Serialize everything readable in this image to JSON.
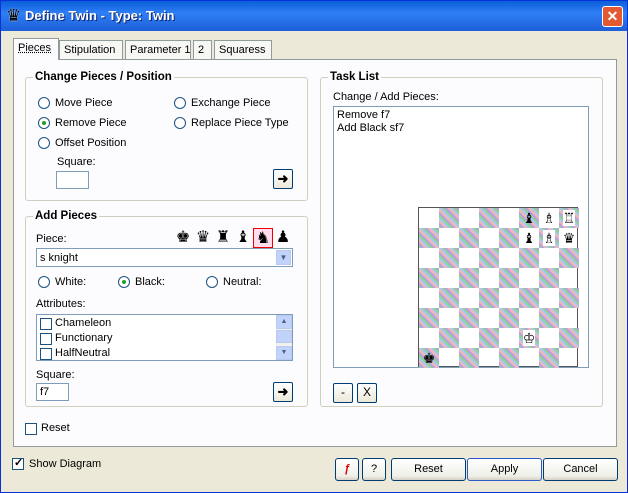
{
  "window": {
    "title": "Define Twin - Type: Twin",
    "app_icon": "queen-icon",
    "close_icon": "close-icon"
  },
  "tabs": [
    {
      "label": "Pieces",
      "active": true
    },
    {
      "label": "Stipulation"
    },
    {
      "label": "Parameter 1"
    },
    {
      "label": "2"
    },
    {
      "label": "Squaress"
    }
  ],
  "change_pieces": {
    "legend": "Change Pieces / Position",
    "options": [
      {
        "label": "Move Piece",
        "selected": false
      },
      {
        "label": "Exchange Piece",
        "selected": false
      },
      {
        "label": "Remove Piece",
        "selected": true
      },
      {
        "label": "Replace Piece Type",
        "selected": false
      },
      {
        "label": "Offset Position",
        "selected": false
      }
    ],
    "square_label": "Square:",
    "square_value": "",
    "apply_icon": "arrow-right-icon"
  },
  "add_pieces": {
    "legend": "Add Pieces",
    "piece_label": "Piece:",
    "piece_value": "s knight",
    "piece_icons": [
      "king-icon",
      "queen-icon",
      "rook-icon",
      "bishop-icon",
      "knight-icon",
      "pawn-icon"
    ],
    "selected_icon": "knight-icon",
    "colors": [
      {
        "label": "White:",
        "selected": false
      },
      {
        "label": "Black:",
        "selected": true
      },
      {
        "label": "Neutral:",
        "selected": false
      }
    ],
    "attributes_label": "Attributes:",
    "attributes": [
      "Chameleon",
      "Functionary",
      "HalfNeutral"
    ],
    "square_label": "Square:",
    "square_value": "f7",
    "apply_icon": "arrow-right-icon"
  },
  "reset_checkbox": {
    "label": "Reset",
    "checked": false
  },
  "task_list": {
    "legend": "Task List",
    "sublabel": "Change / Add Pieces:",
    "items": [
      "Remove f7",
      "Add Black sf7"
    ],
    "remove_label": "-",
    "clear_label": "X"
  },
  "board": {
    "pieces": [
      {
        "rank": 8,
        "file": 6,
        "glyph": "♝",
        "color": "black"
      },
      {
        "rank": 8,
        "file": 7,
        "glyph": "♗",
        "color": "white"
      },
      {
        "rank": 8,
        "file": 8,
        "glyph": "♖",
        "color": "white"
      },
      {
        "rank": 7,
        "file": 6,
        "glyph": "♝",
        "color": "black"
      },
      {
        "rank": 7,
        "file": 7,
        "glyph": "♗",
        "color": "white"
      },
      {
        "rank": 7,
        "file": 8,
        "glyph": "♛",
        "color": "black"
      },
      {
        "rank": 2,
        "file": 6,
        "glyph": "♔",
        "color": "white"
      },
      {
        "rank": 1,
        "file": 1,
        "glyph": "♚",
        "color": "black"
      }
    ]
  },
  "bottom": {
    "show_diagram_label": "Show Diagram",
    "show_diagram_checked": true,
    "flash_icon": "flash-icon",
    "help_icon": "help-icon",
    "reset_label": "Reset",
    "apply_label": "Apply",
    "cancel_label": "Cancel"
  },
  "colors": {
    "title_bar": "#1d5fd7",
    "dialog_bg": "#ece9d8",
    "panel_bg": "#fcfcfe",
    "selected_radio": "#21a121"
  }
}
